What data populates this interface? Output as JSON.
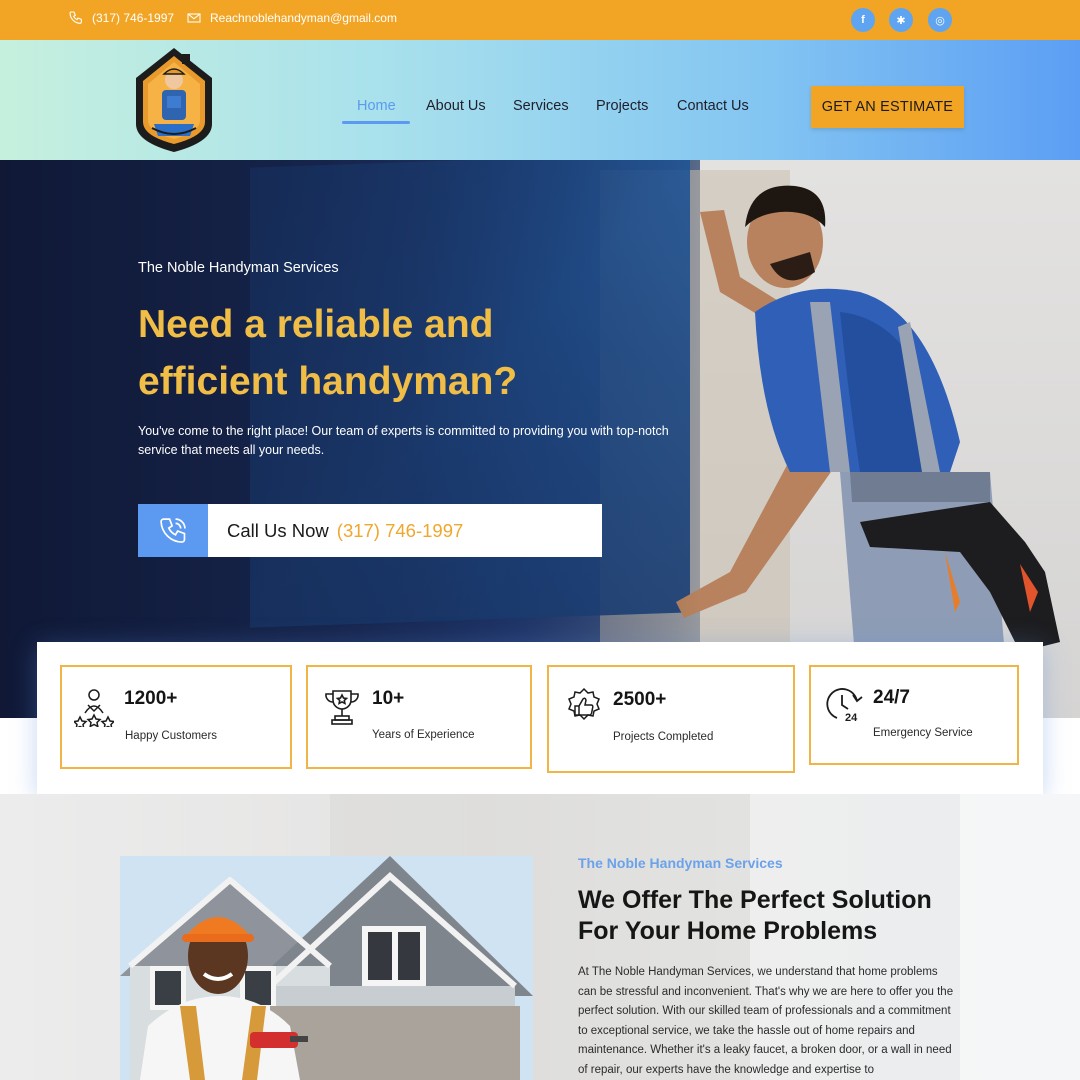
{
  "topbar": {
    "phone": "(317) 746-1997",
    "email": "Reachnoblehandyman@gmail.com",
    "social": [
      {
        "icon": "facebook-icon",
        "glyph": "f"
      },
      {
        "icon": "yelp-icon",
        "glyph": "✱"
      },
      {
        "icon": "instagram-icon",
        "glyph": "◎"
      }
    ]
  },
  "nav": {
    "items": [
      "Home",
      "About Us",
      "Services",
      "Projects",
      "Contact Us"
    ],
    "active": "Home",
    "cta": "GET AN ESTIMATE"
  },
  "hero": {
    "subtitle": "The Noble Handyman Services",
    "title": "Need a reliable and efficient handyman?",
    "text": "You've come to the right place! Our team of experts is committed to providing you with top-notch service that meets all your needs.",
    "call_label": "Call Us Now",
    "call_phone": "(317) 746-1997"
  },
  "stats": [
    {
      "value": "1200+",
      "label": "Happy Customers",
      "icon": "happy-customers-icon"
    },
    {
      "value": "10+",
      "label": "Years of Experience",
      "icon": "trophy-icon"
    },
    {
      "value": "2500+",
      "label": "Projects Completed",
      "icon": "thumbs-up-badge-icon"
    },
    {
      "value": "24/7",
      "label": "Emergency Service",
      "icon": "clock-24-icon"
    }
  ],
  "about": {
    "eyebrow": "The Noble Handyman Services",
    "title": "We Offer The Perfect Solution For Your Home Problems",
    "text": "At The Noble Handyman Services, we understand that home problems can be stressful and inconvenient. That's why we are here to offer you the perfect solution. With our skilled team of professionals and a commitment to exceptional service, we take the hassle out of home repairs and maintenance. Whether it's a leaky faucet, a broken door, or a wall in need of repair, our experts have the knowledge and expertise to"
  },
  "colors": {
    "accent_orange": "#f2a524",
    "accent_blue": "#5b9af0",
    "hero_title": "#f0bd46"
  }
}
